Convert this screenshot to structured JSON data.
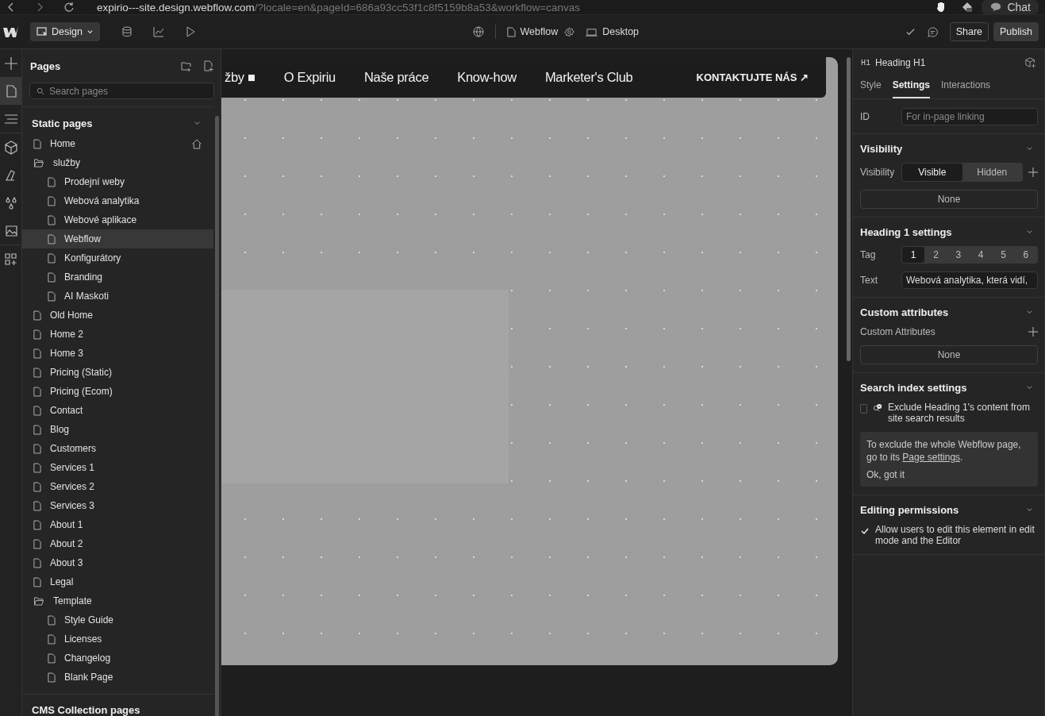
{
  "browser": {
    "url_host": "expirio---site.design.webflow.com",
    "url_path": "/?locale=en&pageId=686a93cc53f1c8f5159b8a53&workflow=canvas",
    "chat": "Chat"
  },
  "toolbar": {
    "mode": "Design",
    "page": "Webflow",
    "breakpoint": "Desktop",
    "share": "Share",
    "publish": "Publish"
  },
  "rail": [
    {
      "kind": "plus",
      "selected": false
    },
    {
      "kind": "page",
      "selected": true
    },
    {
      "kind": "navigator",
      "selected": false
    },
    {
      "kind": "components",
      "selected": false
    },
    {
      "kind": "styles",
      "selected": false
    },
    {
      "kind": "variables",
      "selected": false
    },
    {
      "kind": "assets",
      "selected": false
    },
    {
      "kind": "apps",
      "selected": false
    }
  ],
  "pages": {
    "title": "Pages",
    "search_placeholder": "Search pages",
    "section": "Static pages",
    "expanded": true,
    "items": [
      {
        "kind": "page",
        "label": "Home",
        "home": true,
        "selected": false
      },
      {
        "kind": "folder",
        "label": "služby",
        "selected": false,
        "children": [
          {
            "kind": "page",
            "label": "Prodejní weby",
            "selected": false
          },
          {
            "kind": "page",
            "label": "Webová analytika",
            "selected": false
          },
          {
            "kind": "page",
            "label": "Webové aplikace",
            "selected": false
          },
          {
            "kind": "page",
            "label": "Webflow",
            "selected": true
          },
          {
            "kind": "page",
            "label": "Konfigurátory",
            "selected": false
          },
          {
            "kind": "page",
            "label": "Branding",
            "selected": false
          },
          {
            "kind": "page",
            "label": "AI Maskoti",
            "selected": false
          }
        ]
      },
      {
        "kind": "page",
        "label": "Old Home",
        "selected": false
      },
      {
        "kind": "page",
        "label": "Home 2",
        "selected": false
      },
      {
        "kind": "page",
        "label": "Home 3",
        "selected": false
      },
      {
        "kind": "page",
        "label": "Pricing (Static)",
        "selected": false
      },
      {
        "kind": "page",
        "label": "Pricing (Ecom)",
        "selected": false
      },
      {
        "kind": "page",
        "label": "Contact",
        "selected": false
      },
      {
        "kind": "page",
        "label": "Blog",
        "selected": false
      },
      {
        "kind": "page",
        "label": "Customers",
        "selected": false
      },
      {
        "kind": "page",
        "label": "Services 1",
        "selected": false
      },
      {
        "kind": "page",
        "label": "Services 2",
        "selected": false
      },
      {
        "kind": "page",
        "label": "Services 3",
        "selected": false
      },
      {
        "kind": "page",
        "label": "About 1",
        "selected": false
      },
      {
        "kind": "page",
        "label": "About 2",
        "selected": false
      },
      {
        "kind": "page",
        "label": "About 3",
        "selected": false
      },
      {
        "kind": "page",
        "label": "Legal",
        "selected": false
      },
      {
        "kind": "folder",
        "label": "Template",
        "selected": false,
        "children": [
          {
            "kind": "page",
            "label": "Style Guide",
            "selected": false
          },
          {
            "kind": "page",
            "label": "Licenses",
            "selected": false
          },
          {
            "kind": "page",
            "label": "Changelog",
            "selected": false
          },
          {
            "kind": "page",
            "label": "Blank Page",
            "selected": false
          }
        ]
      }
    ],
    "next_section": "CMS Collection pages"
  },
  "site_nav": {
    "items": [
      "žby ■",
      "O Expiriu",
      "Naše práce",
      "Know-how",
      "Marketer's Club"
    ],
    "cta": "KONTAKTUJTE NÁS ↗"
  },
  "settings": {
    "element_tag": "H1",
    "element_name": "Heading H1",
    "tabs": [
      {
        "label": "Style",
        "selected": false
      },
      {
        "label": "Settings",
        "selected": true
      },
      {
        "label": "Interactions",
        "selected": false
      }
    ],
    "id_label": "ID",
    "id_placeholder": "For in-page linking",
    "visibility": {
      "title": "Visibility",
      "expanded": true,
      "label": "Visibility",
      "options": [
        {
          "label": "Visible",
          "selected": true
        },
        {
          "label": "Hidden",
          "selected": false
        }
      ],
      "value": "None"
    },
    "heading": {
      "title": "Heading 1 settings",
      "expanded": true,
      "tag_label": "Tag",
      "tags": [
        {
          "label": "1",
          "selected": true
        },
        {
          "label": "2",
          "selected": false
        },
        {
          "label": "3",
          "selected": false
        },
        {
          "label": "4",
          "selected": false
        },
        {
          "label": "5",
          "selected": false
        },
        {
          "label": "6",
          "selected": false
        }
      ],
      "text_label": "Text",
      "text_value": "Webová analytika, která vidí,"
    },
    "custom": {
      "title": "Custom attributes",
      "expanded": true,
      "label": "Custom Attributes",
      "value": "None"
    },
    "search": {
      "title": "Search index settings",
      "expanded": true,
      "checked": false,
      "label": "Exclude Heading 1's content from site search results",
      "note": "To exclude the whole Webflow page, go to its",
      "note_link": "Page settings",
      "note_end": ".",
      "dismiss": "Ok, got it"
    },
    "permissions": {
      "title": "Editing permissions",
      "expanded": true,
      "checked": true,
      "label": "Allow users to edit this element in edit mode and the Editor"
    }
  }
}
